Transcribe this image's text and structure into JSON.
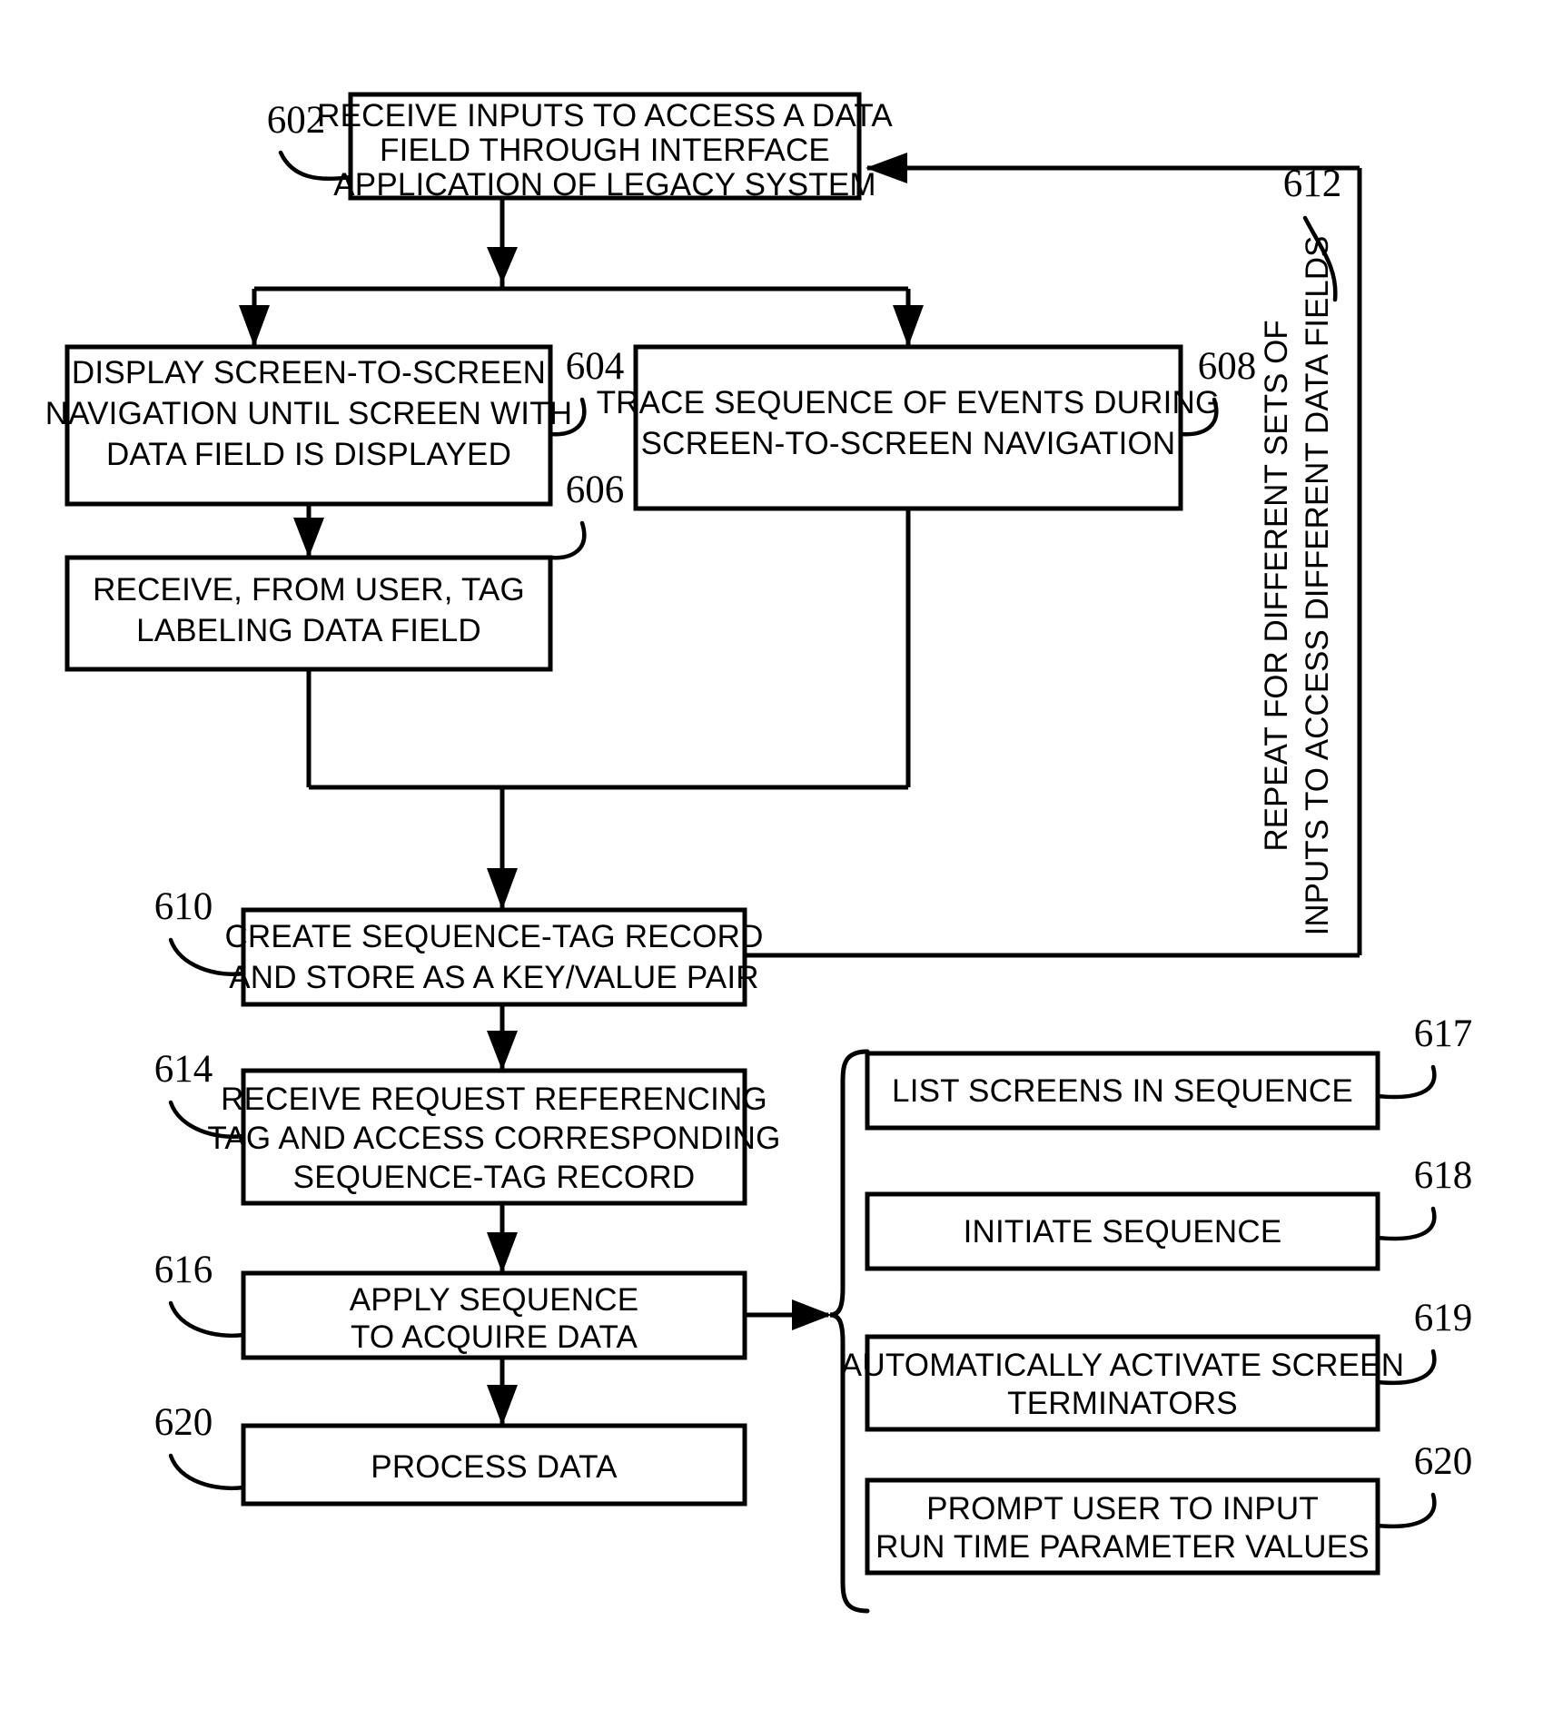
{
  "figure": {
    "type": "patent-flowchart",
    "background": "#ffffff",
    "ink": "#000000"
  },
  "boxes": {
    "b602": {
      "ref": "602",
      "lines": [
        "RECEIVE INPUTS TO ACCESS A DATA",
        "FIELD THROUGH INTERFACE",
        "APPLICATION OF LEGACY SYSTEM"
      ]
    },
    "b604": {
      "ref": "604",
      "lines": [
        "DISPLAY SCREEN-TO-SCREEN",
        "NAVIGATION UNTIL SCREEN WITH",
        "DATA FIELD IS DISPLAYED"
      ]
    },
    "b606": {
      "ref": "606",
      "lines": [
        "RECEIVE, FROM USER, TAG",
        "LABELING DATA FIELD"
      ]
    },
    "b608": {
      "ref": "608",
      "lines": [
        "TRACE SEQUENCE OF EVENTS DURING",
        "SCREEN-TO-SCREEN NAVIGATION"
      ]
    },
    "b610": {
      "ref": "610",
      "lines": [
        "CREATE SEQUENCE-TAG RECORD",
        "AND STORE AS A KEY/VALUE PAIR"
      ]
    },
    "b614": {
      "ref": "614",
      "lines": [
        "RECEIVE REQUEST REFERENCING",
        "TAG AND ACCESS CORRESPONDING",
        "SEQUENCE-TAG RECORD"
      ]
    },
    "b616": {
      "ref": "616",
      "lines": [
        "APPLY SEQUENCE",
        "TO ACQUIRE DATA"
      ]
    },
    "b620": {
      "ref": "620",
      "lines": [
        "PROCESS DATA"
      ]
    },
    "b617": {
      "ref": "617",
      "lines": [
        "LIST SCREENS IN SEQUENCE"
      ]
    },
    "b618": {
      "ref": "618",
      "lines": [
        "INITIATE SEQUENCE"
      ]
    },
    "b619": {
      "ref": "619",
      "lines": [
        "AUTOMATICALLY ACTIVATE SCREEN",
        "TERMINATORS"
      ]
    },
    "b620r": {
      "ref": "620",
      "lines": [
        "PROMPT USER TO INPUT",
        "RUN TIME PARAMETER VALUES"
      ]
    }
  },
  "annotations": {
    "feedback_loop": {
      "ref": "612",
      "lines": [
        "REPEAT FOR DIFFERENT SETS OF",
        "INPUTS TO ACCESS DIFFERENT DATA FIELDS"
      ]
    }
  }
}
